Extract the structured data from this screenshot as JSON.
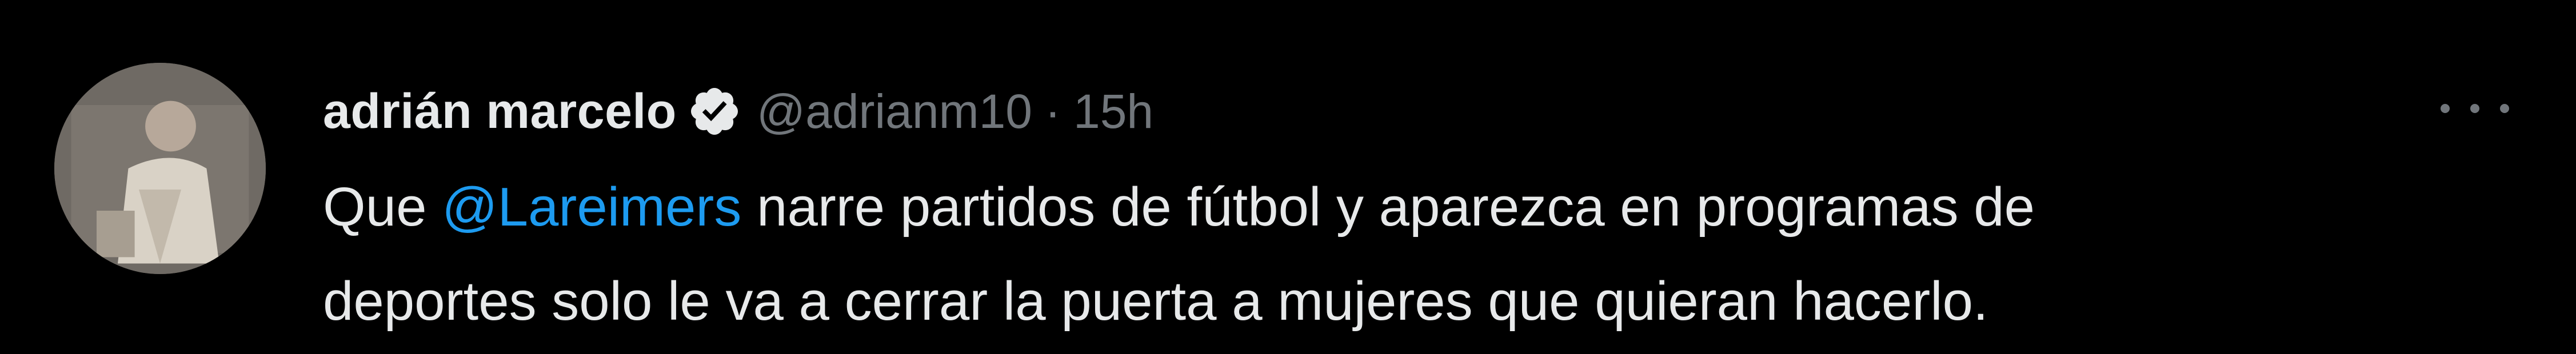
{
  "tweet": {
    "author": {
      "display_name": "adrián marcelo",
      "handle": "@adrianm10",
      "verified": true,
      "avatar_icon": "profile-photo"
    },
    "separator": "·",
    "time": "15h",
    "body": {
      "prefix": "Que ",
      "mention": "@Lareimers",
      "rest_line1": " narre partidos de fútbol y aparezca en programas de",
      "line2": "deportes solo le va a cerrar la puerta a mujeres que quieran hacerlo."
    },
    "more_icon": "more-horizontal-icon"
  },
  "colors": {
    "background": "#000000",
    "text": "#e7e9ea",
    "secondary": "#71767b",
    "mention": "#1d9bf0"
  }
}
